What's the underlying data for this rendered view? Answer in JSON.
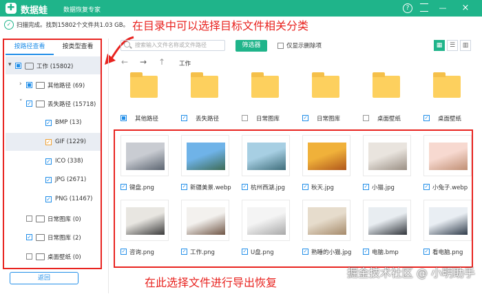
{
  "app": {
    "logo_char": "✚",
    "name": "数据蛙",
    "subtitle": "数据恢复专家"
  },
  "status": {
    "text": "扫描完成。找到15802个文件共1.03 GB。"
  },
  "annotations": {
    "top": "在目录中可以选择目标文件相关分类",
    "bottom": "在此选择文件进行导出恢复"
  },
  "watermark": "掘金技术社区 @ 小明助手",
  "tabs": {
    "path": "按路径查看",
    "type": "按类型查看"
  },
  "tree": [
    {
      "label": "工作 (15802)",
      "level": 0,
      "arrow": "▾",
      "check": "part",
      "icon": "drive",
      "selected": true
    },
    {
      "label": "其他路径 (69)",
      "level": 1,
      "arrow": "›",
      "check": "part",
      "icon": "folder"
    },
    {
      "label": "丢失路径 (15718)",
      "level": 1,
      "arrow": "˅",
      "check": "on",
      "icon": "folder"
    },
    {
      "label": "BMP (13)",
      "level": 2,
      "check": "on"
    },
    {
      "label": "GIF (1229)",
      "level": 2,
      "check": "on",
      "selected": true
    },
    {
      "label": "ICO (338)",
      "level": 2,
      "check": "on"
    },
    {
      "label": "JPG (2671)",
      "level": 2,
      "check": "on"
    },
    {
      "label": "PNG (11467)",
      "level": 2,
      "check": "on"
    },
    {
      "label": "日常图库 (0)",
      "level": 1,
      "check": "off",
      "icon": "folder"
    },
    {
      "label": "日常图库 (2)",
      "level": 1,
      "check": "on",
      "icon": "folder"
    },
    {
      "label": "桌面壁纸 (0)",
      "level": 1,
      "check": "off",
      "icon": "folder"
    }
  ],
  "back_button": "返回",
  "toolbar": {
    "search_placeholder": "搜索输入文件名称或文件路径",
    "filter": "筛选器",
    "only_deleted": "仅显示删除项",
    "view_icons": [
      "▦",
      "☰",
      "▥"
    ]
  },
  "breadcrumb": {
    "back": "←",
    "forward": "→",
    "up": "↑",
    "path": "工作"
  },
  "folders": [
    {
      "name": "其他路径",
      "checked": "part"
    },
    {
      "name": "丢失路径",
      "checked": "on"
    },
    {
      "name": "日常图库",
      "checked": "off"
    },
    {
      "name": "日常图库",
      "checked": "on"
    },
    {
      "name": "桌面壁纸",
      "checked": "off"
    },
    {
      "name": "桌面壁纸",
      "checked": "on"
    }
  ],
  "files": [
    {
      "name": "键盘.png",
      "icon": "keyboard-photo",
      "colors": [
        "#c9ccd2",
        "#5b6470"
      ]
    },
    {
      "name": "新疆美景.webp",
      "icon": "landscape-photo",
      "colors": [
        "#6fb3e8",
        "#3d6b55"
      ]
    },
    {
      "name": "杭州西湖.jpg",
      "icon": "lake-photo",
      "colors": [
        "#a7cfe3",
        "#3e6d7a"
      ]
    },
    {
      "name": "秋天.jpg",
      "icon": "autumn-photo",
      "colors": [
        "#f0b13a",
        "#b0571b"
      ]
    },
    {
      "name": "小猫.jpg",
      "icon": "kitten-photo",
      "colors": [
        "#e9e4de",
        "#9a8f84"
      ]
    },
    {
      "name": "小兔子.webp",
      "icon": "rabbit-photo",
      "colors": [
        "#f7d9d0",
        "#c08f74"
      ]
    },
    {
      "name": "咨询.png",
      "icon": "office-photo",
      "colors": [
        "#e8e6e1",
        "#3a3a3a"
      ]
    },
    {
      "name": "工作.png",
      "icon": "work-photo",
      "colors": [
        "#f3f1ee",
        "#6f5545"
      ]
    },
    {
      "name": "U盘.png",
      "icon": "usb-photo",
      "colors": [
        "#f4f4f4",
        "#a8a8a8"
      ]
    },
    {
      "name": "熟睡的小猫.jpg",
      "icon": "sleeping-cat-photo",
      "colors": [
        "#e6dccc",
        "#a58a6a"
      ]
    },
    {
      "name": "电脑.bmp",
      "icon": "laptop-photo",
      "colors": [
        "#e8edf1",
        "#30343a"
      ]
    },
    {
      "name": "看电脑.png",
      "icon": "person-laptop-photo",
      "colors": [
        "#e9eef3",
        "#2f3b4a"
      ]
    }
  ],
  "colors": {
    "accent": "#1fb48a",
    "link": "#1f8de8",
    "annotation": "#e8231f"
  }
}
